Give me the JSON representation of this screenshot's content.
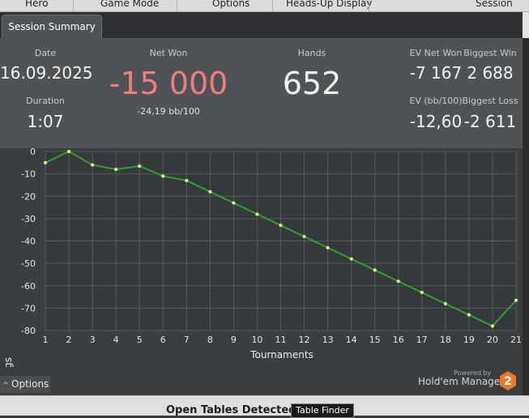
{
  "menu": [
    "Hero",
    "Game Mode",
    "Options",
    "Heads-Up Display",
    "Session"
  ],
  "tab": {
    "label": "Session Summary"
  },
  "summary": {
    "date_label": "Date",
    "date": "16.09.2025",
    "duration_label": "Duration",
    "duration": "1:07",
    "net_won_label": "Net Won",
    "net_won": "-15 000",
    "net_won_rate": "-24,19 bb/100",
    "hands_label": "Hands",
    "hands": "652",
    "ev_net_won_label": "EV Net Won",
    "ev_net_won": "-7 167",
    "biggest_win_label": "Biggest Win",
    "biggest_win": "2 688",
    "ev_bb_label": "EV (bb/100)",
    "ev_bb": "-12,60",
    "biggest_loss_label": "Biggest Loss",
    "biggest_loss": "-2 611"
  },
  "colors": {
    "net_won": "#ef7f7f",
    "line": "#2f9e30",
    "point": "#e6ff8a",
    "logo": "#e87a2a"
  },
  "chart_data": {
    "type": "line",
    "xlabel": "Tournaments",
    "ylabel": "Net Winnings",
    "xlim": [
      1,
      21
    ],
    "ylim": [
      -80,
      0
    ],
    "x": [
      1,
      2,
      3,
      4,
      5,
      6,
      7,
      8,
      9,
      10,
      11,
      12,
      13,
      14,
      15,
      16,
      17,
      18,
      19,
      20,
      21
    ],
    "yticks": [
      0,
      -10,
      -20,
      -30,
      -40,
      -50,
      -60,
      -70,
      -80
    ],
    "grid": true,
    "series": [
      {
        "values": [
          -5,
          0,
          -6,
          -8,
          -6.5,
          -11,
          -13,
          -18,
          -23,
          -28,
          -33,
          -38,
          -43,
          -48,
          -53,
          -58,
          -63,
          -68,
          -73,
          -78,
          -66.5
        ]
      }
    ]
  },
  "options": {
    "label": "Options",
    "caret": "^"
  },
  "brand": {
    "powered": "Powered by",
    "name": "Hold'em Manager",
    "badge": "2"
  },
  "bottom": {
    "open_tables": "Open Tables Detected",
    "table_finder": "Table Finder"
  }
}
